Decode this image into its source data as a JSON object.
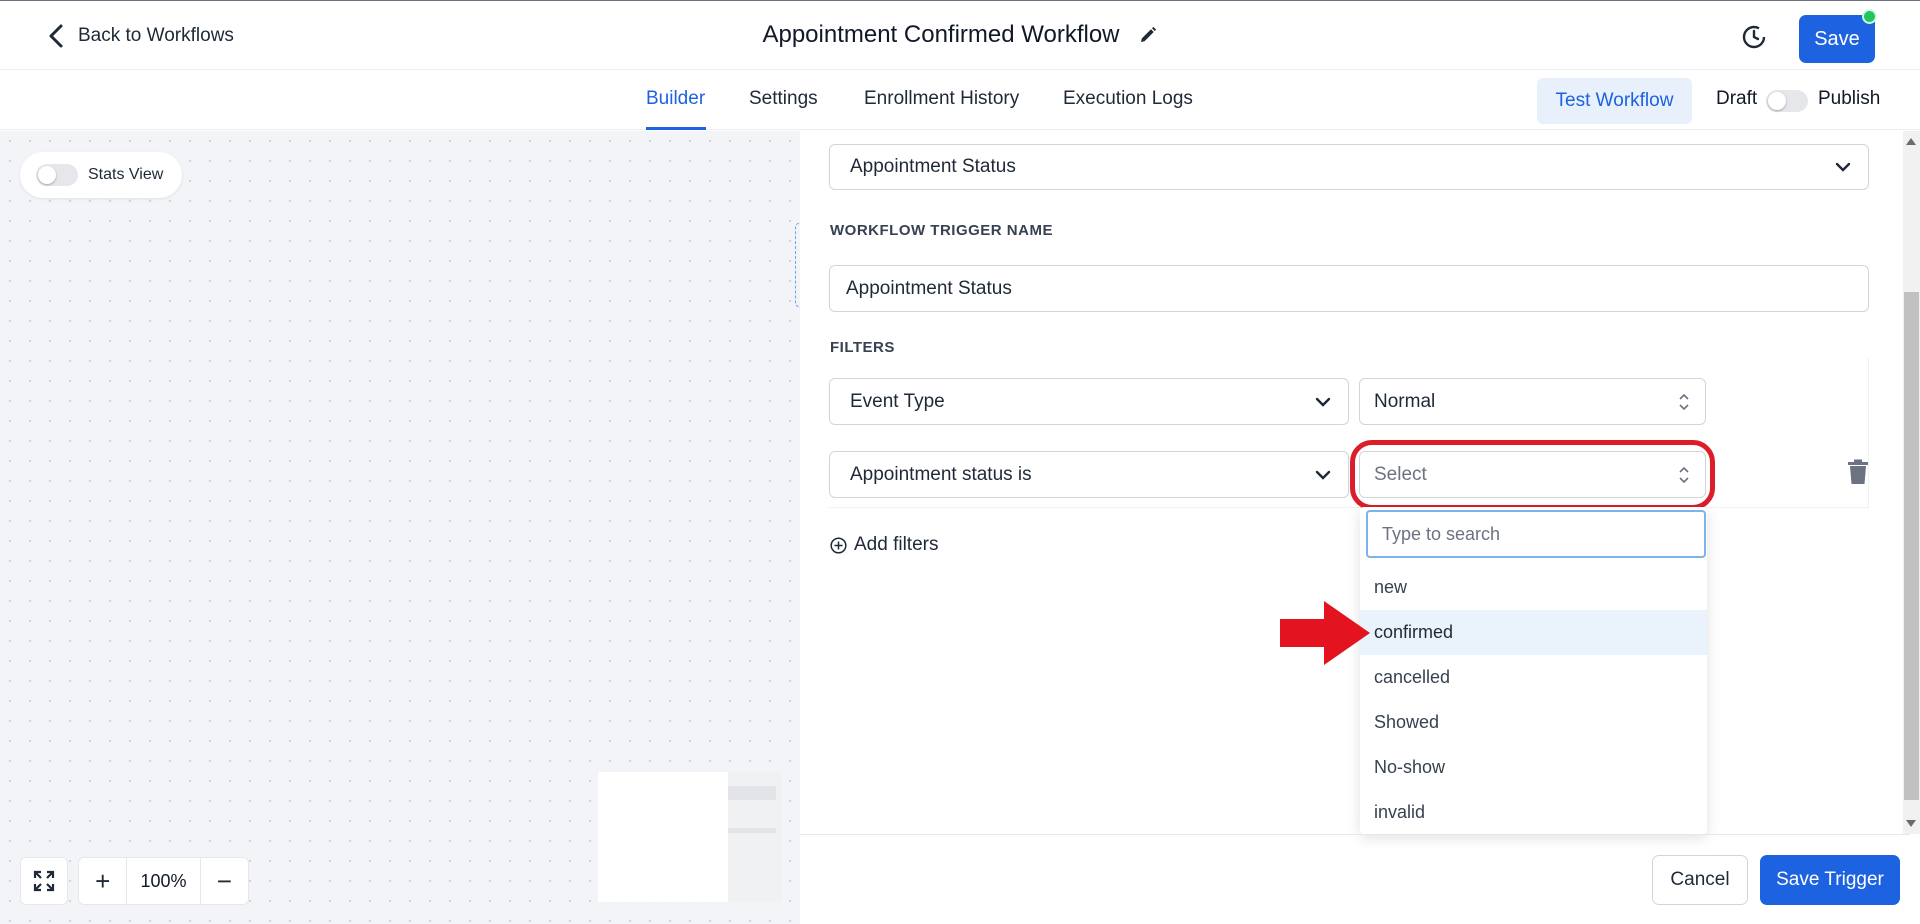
{
  "header": {
    "back_label": "Back to Workflows",
    "title": "Appointment Confirmed Workflow",
    "save_label": "Save"
  },
  "tabs": [
    {
      "label": "Builder",
      "active": true
    },
    {
      "label": "Settings",
      "active": false
    },
    {
      "label": "Enrollment History",
      "active": false
    },
    {
      "label": "Execution Logs",
      "active": false
    }
  ],
  "toolbar": {
    "test_label": "Test Workflow",
    "draft_label": "Draft",
    "publish_label": "Publish"
  },
  "canvas": {
    "stats_view_label": "Stats View",
    "zoom_level": "100%",
    "zoom_in": "+",
    "zoom_out": "−"
  },
  "trigger_panel": {
    "trigger_type": "Appointment Status",
    "trigger_name_label": "WORKFLOW TRIGGER NAME",
    "trigger_name_value": "Appointment Status",
    "filters_label": "FILTERS",
    "filters": [
      {
        "field": "Event Type",
        "value": "Normal"
      },
      {
        "field": "Appointment status is",
        "value": "",
        "placeholder": "Select"
      }
    ],
    "add_filters_label": "Add filters",
    "cancel_label": "Cancel",
    "save_trigger_label": "Save Trigger"
  },
  "dropdown": {
    "search_placeholder": "Type to search",
    "options": [
      "new",
      "confirmed",
      "cancelled",
      "Showed",
      "No-show",
      "invalid"
    ],
    "highlighted": "confirmed"
  },
  "colors": {
    "primary": "#1d62e0",
    "annotation_red": "#dc1d2a",
    "online_dot": "#22c55e"
  }
}
